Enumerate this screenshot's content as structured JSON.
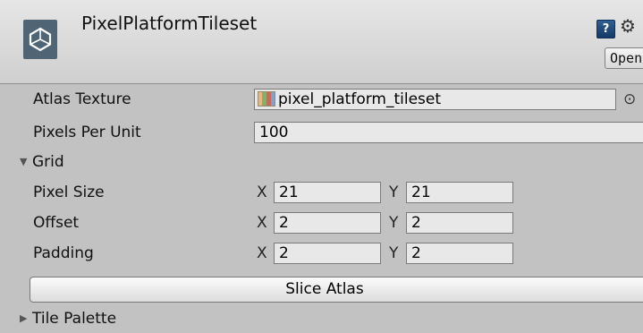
{
  "header": {
    "asset_name": "PixelPlatformTileset",
    "asset_icon": "unity-logo-icon",
    "help_icon_glyph": "?",
    "settings_icon_glyph": "⚙",
    "open_label": "Open"
  },
  "properties": {
    "atlas_texture": {
      "label": "Atlas Texture",
      "value": "pixel_platform_tileset",
      "picker_glyph": "⊙"
    },
    "pixels_per_unit": {
      "label": "Pixels Per Unit",
      "value": "100"
    }
  },
  "grid": {
    "label": "Grid",
    "expanded": true,
    "pixel_size": {
      "label": "Pixel Size",
      "x_label": "X",
      "x": "21",
      "y_label": "Y",
      "y": "21"
    },
    "offset": {
      "label": "Offset",
      "x_label": "X",
      "x": "2",
      "y_label": "Y",
      "y": "2"
    },
    "padding": {
      "label": "Padding",
      "x_label": "X",
      "x": "2",
      "y_label": "Y",
      "y": "2"
    }
  },
  "actions": {
    "slice_label": "Slice Atlas"
  },
  "tile_palette": {
    "label": "Tile Palette",
    "expanded": false
  },
  "colors": {
    "background": "#c2c2c2",
    "field": "#e8e8e8",
    "header": "#dcdcdc"
  }
}
